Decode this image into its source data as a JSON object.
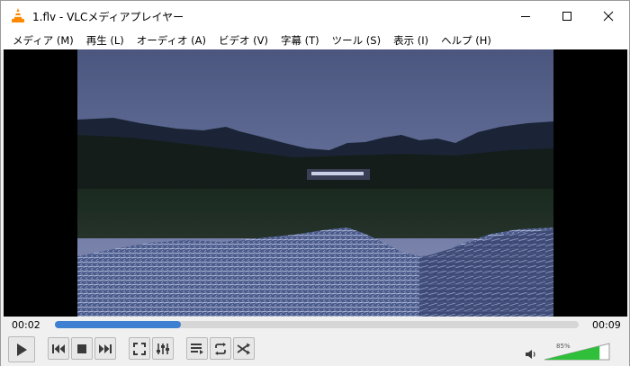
{
  "window": {
    "title": "1.flv - VLCメディアプレイヤー"
  },
  "menu": {
    "items": [
      {
        "label": "メディア (M)"
      },
      {
        "label": "再生 (L)"
      },
      {
        "label": "オーディオ (A)"
      },
      {
        "label": "ビデオ (V)"
      },
      {
        "label": "字幕 (T)"
      },
      {
        "label": "ツール (S)"
      },
      {
        "label": "表示 (I)"
      },
      {
        "label": "ヘルプ (H)"
      }
    ]
  },
  "playback": {
    "elapsed": "00:02",
    "total": "00:09",
    "progress_fraction": 0.24
  },
  "volume": {
    "label": "85%",
    "level_fraction": 0.85
  },
  "colors": {
    "accent": "#3d7fd1",
    "volume_fill": "#2fbf3a",
    "vlc_orange": "#ff8800"
  },
  "icons": {
    "app": "vlc-cone-icon",
    "minimize": "minimize-icon",
    "maximize": "maximize-icon",
    "close": "close-icon",
    "play": "play-icon",
    "prev": "previous-icon",
    "stop": "stop-icon",
    "next": "next-icon",
    "fullscreen": "fullscreen-icon",
    "extended": "extended-settings-icon",
    "playlist": "playlist-icon",
    "loop": "loop-icon",
    "shuffle": "shuffle-icon",
    "speaker": "speaker-icon"
  }
}
